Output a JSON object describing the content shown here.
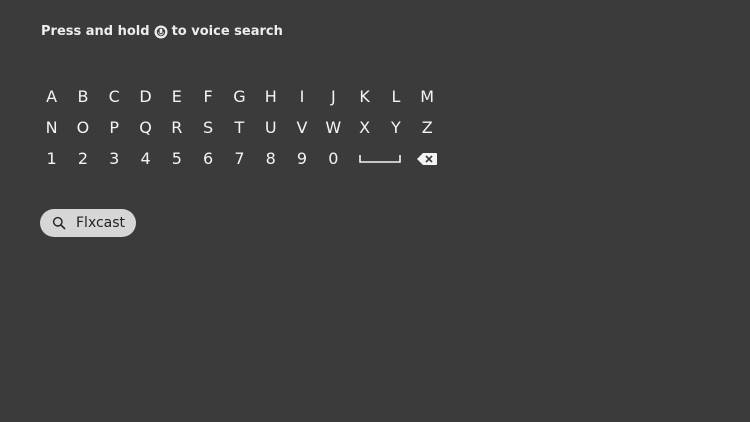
{
  "voice_hint": {
    "before": "Press and hold",
    "icon": "voice-remote-icon",
    "after": "to voice search"
  },
  "keyboard": {
    "rows": [
      [
        "A",
        "B",
        "C",
        "D",
        "E",
        "F",
        "G",
        "H",
        "I",
        "J",
        "K",
        "L",
        "M"
      ],
      [
        "N",
        "O",
        "P",
        "Q",
        "R",
        "S",
        "T",
        "U",
        "V",
        "W",
        "X",
        "Y",
        "Z"
      ],
      [
        "1",
        "2",
        "3",
        "4",
        "5",
        "6",
        "7",
        "8",
        "9",
        "0"
      ]
    ],
    "special_keys": {
      "space": "space-key-icon",
      "backspace": "backspace-icon"
    }
  },
  "suggestions": [
    {
      "text": "Flxcast",
      "icon": "search-icon"
    }
  ],
  "colors": {
    "background": "#3b3b3b",
    "text": "#f2f2f2",
    "pill": "#d6d6d6",
    "pill_text": "#222222"
  }
}
